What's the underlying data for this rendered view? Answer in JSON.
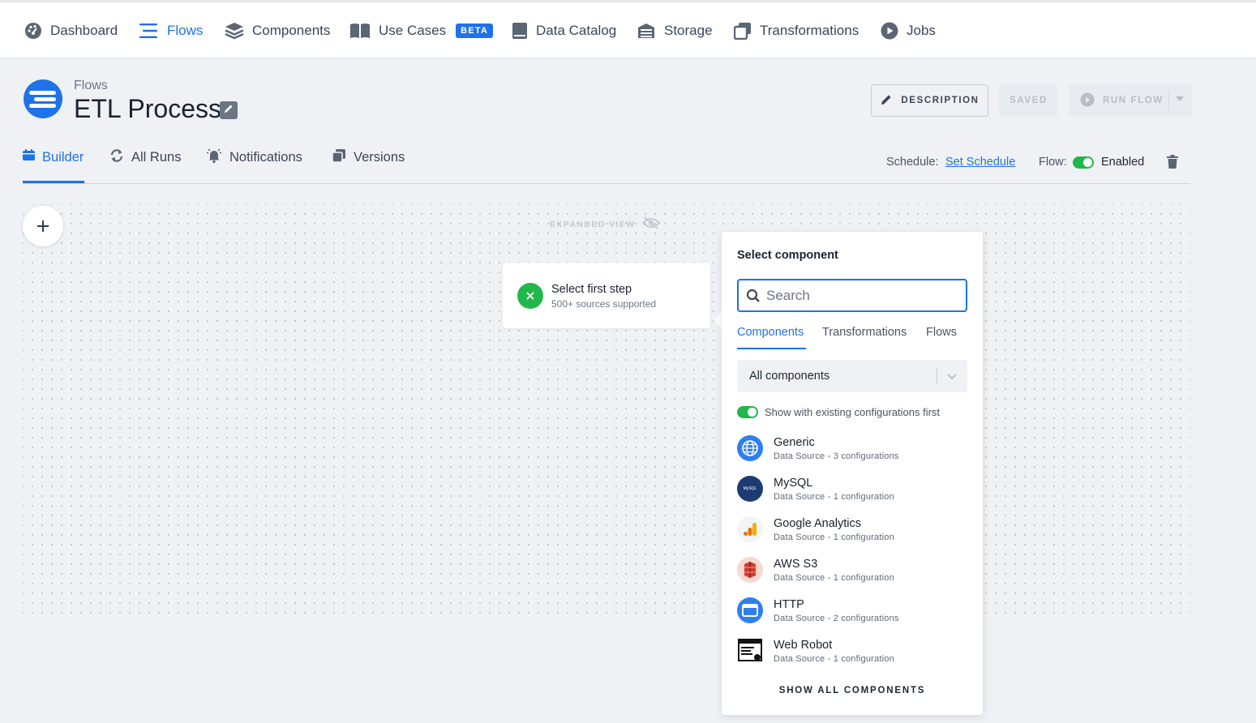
{
  "nav": {
    "items": [
      {
        "label": "Dashboard",
        "icon": "dashboard-icon"
      },
      {
        "label": "Flows",
        "icon": "flows-icon",
        "active": true
      },
      {
        "label": "Components",
        "icon": "components-icon"
      },
      {
        "label": "Use Cases",
        "icon": "book-icon",
        "badge": "BETA"
      },
      {
        "label": "Data Catalog",
        "icon": "data-catalog-icon"
      },
      {
        "label": "Storage",
        "icon": "storage-icon"
      },
      {
        "label": "Transformations",
        "icon": "transformations-icon"
      },
      {
        "label": "Jobs",
        "icon": "jobs-icon"
      }
    ]
  },
  "header": {
    "breadcrumb": "Flows",
    "title": "ETL Process",
    "description_button": "DESCRIPTION",
    "saved_button": "SAVED",
    "run_button": "RUN FLOW"
  },
  "tabs": [
    {
      "label": "Builder",
      "active": true
    },
    {
      "label": "All Runs"
    },
    {
      "label": "Notifications"
    },
    {
      "label": "Versions"
    }
  ],
  "schedule": {
    "label": "Schedule:",
    "link": "Set Schedule",
    "flow_label": "Flow:",
    "flow_status": "Enabled"
  },
  "canvas": {
    "expanded_view": "EXPANDED VIEW",
    "step_title": "Select first step",
    "step_subtitle": "500+ sources supported"
  },
  "popover": {
    "title": "Select component",
    "search_placeholder": "Search",
    "tabs": [
      "Components",
      "Transformations",
      "Flows"
    ],
    "filter_value": "All components",
    "toggle_label": "Show with existing configurations first",
    "components": [
      {
        "name": "Generic",
        "desc": "Data Source - 3 configurations",
        "icon": "globe-icon"
      },
      {
        "name": "MySQL",
        "desc": "Data Source - 1 configuration",
        "icon": "mysql-icon",
        "icon_text": "MySQL"
      },
      {
        "name": "Google Analytics",
        "desc": "Data Source - 1 configuration",
        "icon": "google-analytics-icon"
      },
      {
        "name": "AWS S3",
        "desc": "Data Source - 1 configuration",
        "icon": "aws-s3-icon"
      },
      {
        "name": "HTTP",
        "desc": "Data Source - 2 configurations",
        "icon": "http-icon"
      },
      {
        "name": "Web Robot",
        "desc": "Data Source - 1 configuration",
        "icon": "web-robot-icon"
      }
    ],
    "show_all": "SHOW ALL COMPONENTS"
  },
  "colors": {
    "accent": "#1f72e8",
    "success": "#21b84a",
    "background": "#eff1f5"
  }
}
